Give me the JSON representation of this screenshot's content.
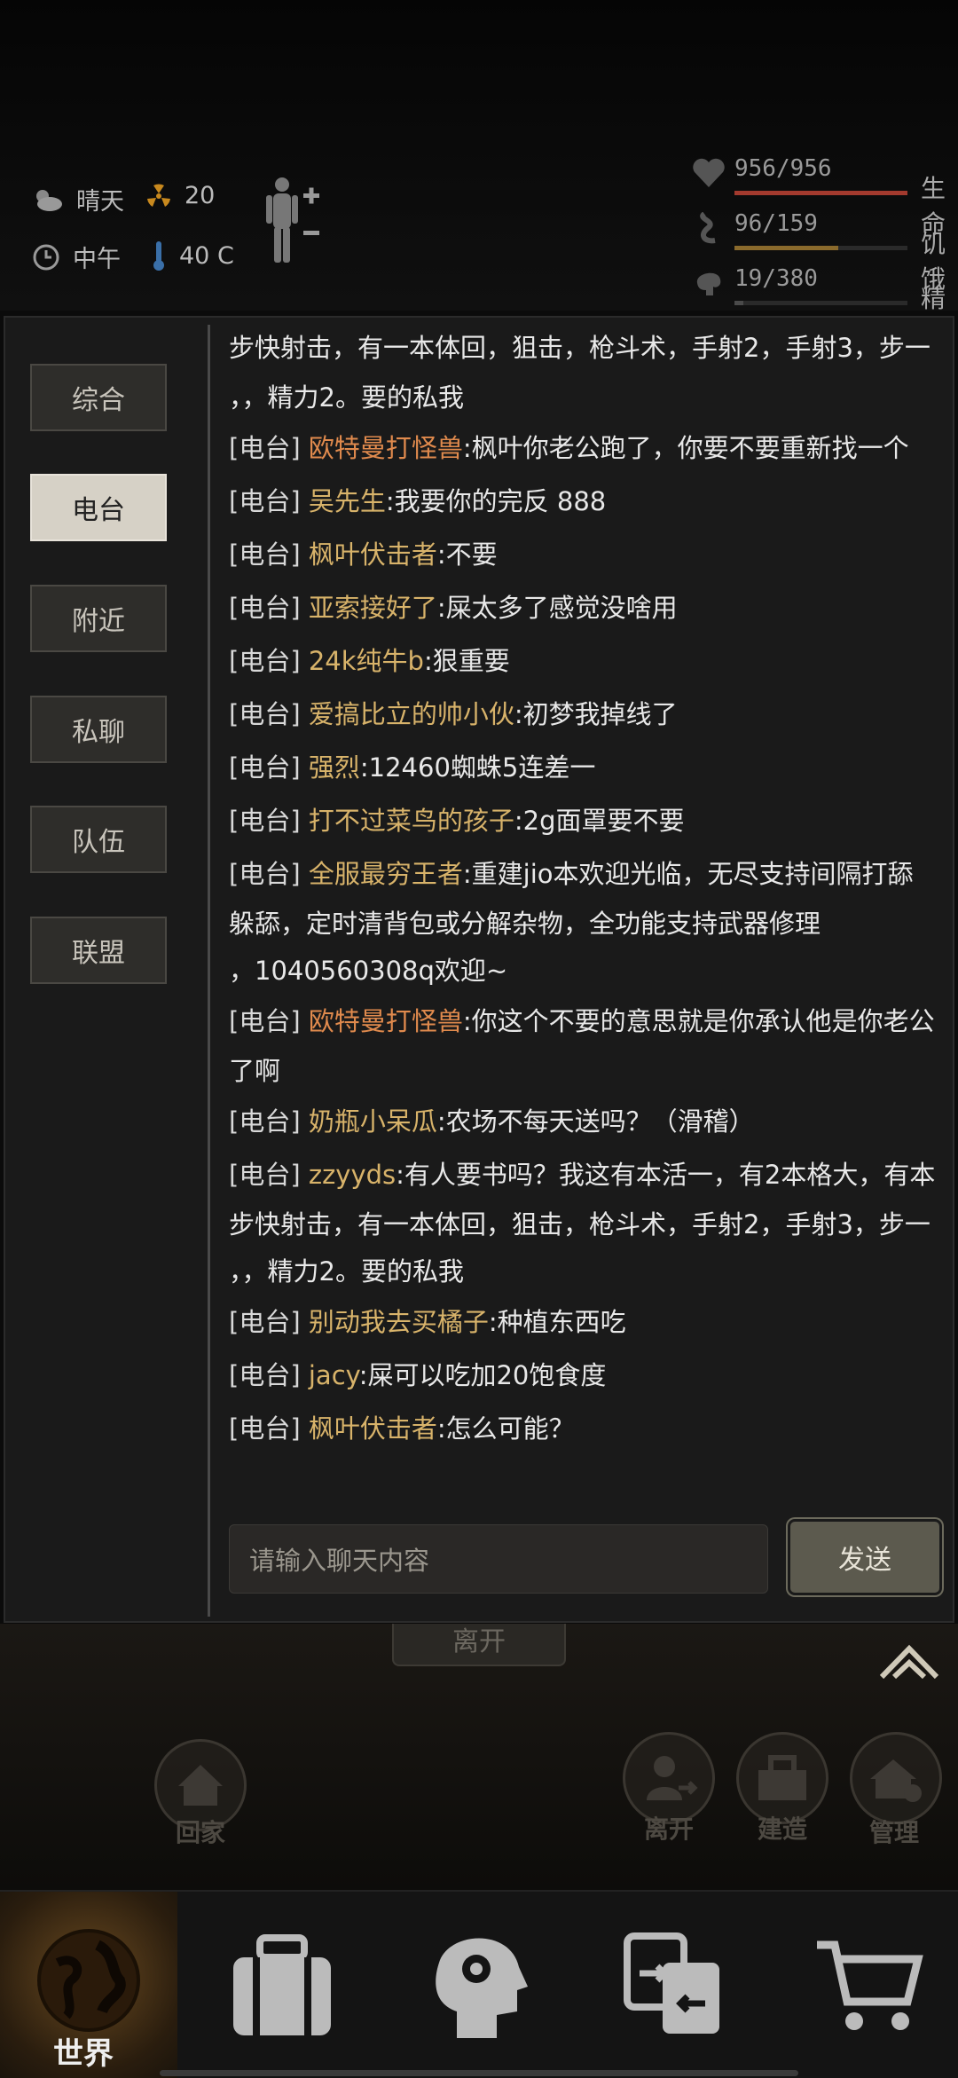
{
  "status": {
    "weather": "晴天",
    "radiation": "20",
    "time_of_day": "中午",
    "temperature": "40 C"
  },
  "vitals": [
    {
      "value": "956/956",
      "label": "生命",
      "fill": 1.0,
      "color": "#a33a2e"
    },
    {
      "value": "96/159",
      "label": "饥饿",
      "fill": 0.6,
      "color": "#8a6a2c"
    },
    {
      "value": "19/380",
      "label": "精力",
      "fill": 0.05,
      "color": "#4a4a4a"
    }
  ],
  "tabs": [
    "综合",
    "电台",
    "附近",
    "私聊",
    "队伍",
    "联盟"
  ],
  "active_tab": "电台",
  "messages": [
    {
      "tag": "",
      "name": "",
      "name_color": "",
      "lines": [
        "步快射击，有一本体回，狙击，枪斗术，手射2，手射3，步一",
        "，，精力2。要的私我"
      ]
    },
    {
      "tag": "[电台]",
      "name": "欧特曼打怪兽",
      "name_color": "orange",
      "lines": [
        ":枫叶你老公跑了，你要不要重新找一个"
      ]
    },
    {
      "tag": "[电台]",
      "name": "吴先生",
      "name_color": "gold",
      "lines": [
        ":我要你的完反 888"
      ]
    },
    {
      "tag": "[电台]",
      "name": "枫叶伏击者",
      "name_color": "gold",
      "lines": [
        ":不要"
      ]
    },
    {
      "tag": "[电台]",
      "name": "亚索接好了",
      "name_color": "gold",
      "lines": [
        ":屎太多了感觉没啥用"
      ]
    },
    {
      "tag": "[电台]",
      "name": "24k纯牛b",
      "name_color": "gold",
      "lines": [
        ":狠重要"
      ]
    },
    {
      "tag": "[电台]",
      "name": "爱搞比立的帅小伙",
      "name_color": "gold",
      "lines": [
        ":初梦我掉线了"
      ]
    },
    {
      "tag": "[电台]",
      "name": "强烈",
      "name_color": "gold",
      "lines": [
        ":12460蜘蛛5连差一"
      ]
    },
    {
      "tag": "[电台]",
      "name": "打不过菜鸟的孩子",
      "name_color": "gold",
      "lines": [
        ":2g面罩要不要"
      ]
    },
    {
      "tag": "[电台]",
      "name": "全服最穷王者",
      "name_color": "gold",
      "lines": [
        ":重建jio本欢迎光临，无尽支持间隔打舔",
        "躲舔，定时清背包或分解杂物，全功能支持武器修理",
        "，1040560308q欢迎~"
      ]
    },
    {
      "tag": "[电台]",
      "name": "欧特曼打怪兽",
      "name_color": "orange",
      "lines": [
        ":你这个不要的意思就是你承认他是你老公",
        "了啊"
      ]
    },
    {
      "tag": "[电台]",
      "name": "奶瓶小呆瓜",
      "name_color": "gold",
      "lines": [
        ":农场不每天送吗？（滑稽）"
      ]
    },
    {
      "tag": "[电台]",
      "name": "zzyyds",
      "name_color": "gold",
      "lines": [
        ":有人要书吗？我这有本活一，有2本格大，有本",
        "步快射击，有一本体回，狙击，枪斗术，手射2，手射3，步一",
        "，，精力2。要的私我"
      ]
    },
    {
      "tag": "[电台]",
      "name": "别动我去买橘子",
      "name_color": "gold",
      "lines": [
        ":种植东西吃"
      ]
    },
    {
      "tag": "[电台]",
      "name": "jacy",
      "name_color": "gold",
      "lines": [
        ":屎可以吃加20饱食度"
      ]
    },
    {
      "tag": "[电台]",
      "name": "枫叶伏击者",
      "name_color": "gold",
      "lines": [
        ":怎么可能？"
      ]
    }
  ],
  "input": {
    "placeholder": "请输入聊天内容",
    "value": ""
  },
  "send_label": "发送",
  "behind": {
    "leave_small": "离开",
    "actions": [
      {
        "label": "回家",
        "icon": "home-icon"
      },
      {
        "label": "离开",
        "icon": "leave-icon"
      },
      {
        "label": "建造",
        "icon": "build-icon"
      },
      {
        "label": "管理",
        "icon": "manage-icon"
      }
    ]
  },
  "nav": [
    {
      "label": "世界",
      "icon": "globe-icon"
    },
    {
      "label": "",
      "icon": "backpack-icon"
    },
    {
      "label": "",
      "icon": "skills-icon"
    },
    {
      "label": "",
      "icon": "trade-icon"
    },
    {
      "label": "",
      "icon": "cart-icon"
    }
  ]
}
